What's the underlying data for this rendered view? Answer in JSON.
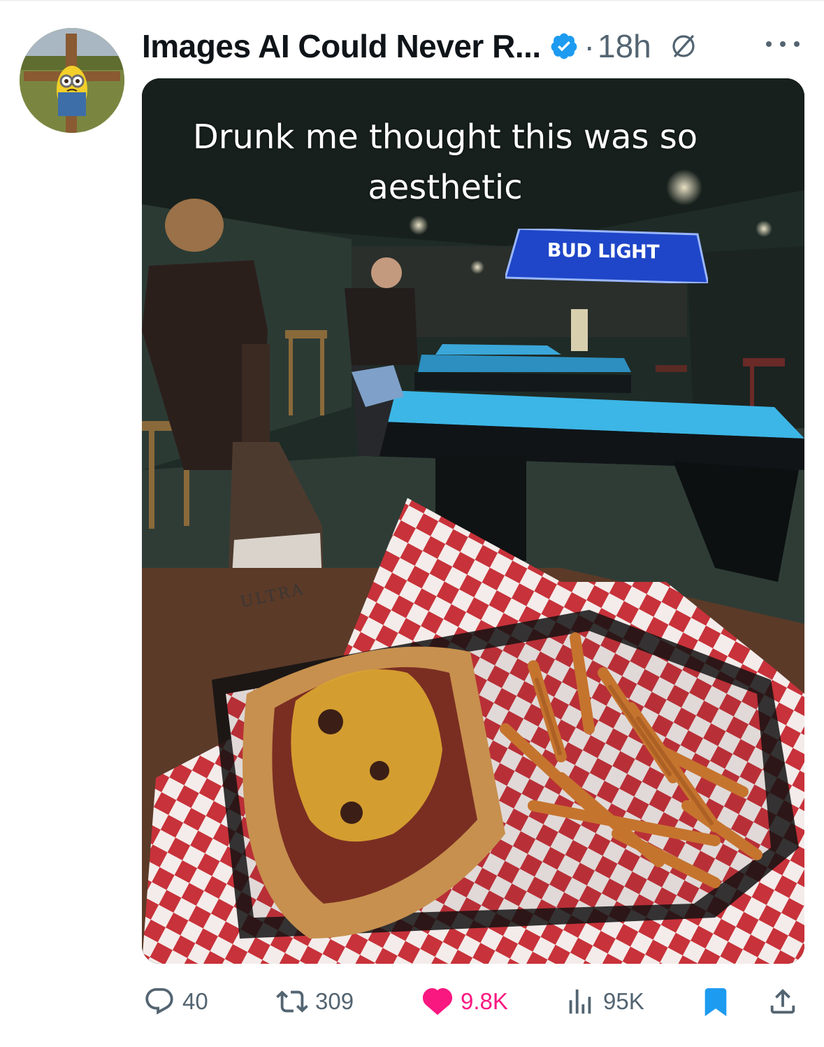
{
  "post": {
    "author_name": "Images AI Could Never R...",
    "separator": "·",
    "timestamp": "18h",
    "caption": "Drunk me thought this was so aesthetic",
    "scene_text": {
      "sign": "BUD LIGHT",
      "bottle": "ULTRA"
    }
  },
  "actions": {
    "replies": "40",
    "reposts": "309",
    "likes": "9.8K",
    "views": "95K"
  },
  "colors": {
    "verified": "#1d9bf0",
    "like": "#f91880",
    "bookmark": "#1d9bf0",
    "muted": "#536471"
  },
  "icons": [
    "verified-badge-icon",
    "grok-icon",
    "more-icon",
    "reply-icon",
    "repost-icon",
    "like-icon",
    "views-icon",
    "bookmark-icon",
    "share-icon"
  ]
}
